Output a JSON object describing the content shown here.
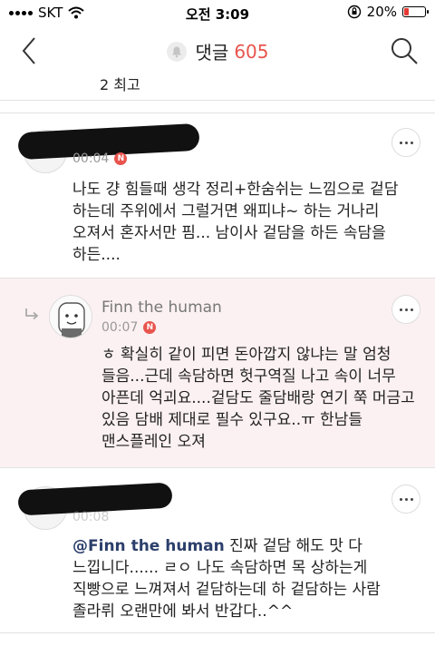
{
  "status_bar": {
    "carrier": "SKT",
    "time": "오전 3:09",
    "battery_percent": "20%",
    "battery_level": 0.2
  },
  "header": {
    "title": "댓글",
    "count": "605"
  },
  "sort": {
    "label": "2  최고"
  },
  "comments": [
    {
      "time": "00:04",
      "badge": "N",
      "lines": [
        "나도 걍 힘들때 생각 정리+한숨쉬는 느낌으로 겉담",
        "하는데 주위에서 그럴거면 왜피냐~ 하는 거나리",
        "오져서 혼자서만 핌... 남이사 겉담을 하든 속담을",
        "하든...."
      ]
    },
    {
      "author": "Finn the human",
      "time": "00:07",
      "badge": "N",
      "lines": [
        "ㅎ 확실히 같이 피면 돈아깝지 않냐는 말 엄청",
        "들음...근데 속담하면 헛구역질 나고 속이 너무",
        "아픈데 억괴요....겉담도 줄담배랑 연기 쭉 머금고",
        "있음 담배 제대로 필수 있구요..ㅠ 한남들",
        "맨스플레인 오져"
      ]
    },
    {
      "time": "00:08",
      "mention": "@Finn the human",
      "lines": [
        " 진짜 겉담 해도 맛 다",
        "느낍니다...... ㄹㅇ 나도 속담하면 목 상하는게",
        "직빵으로 느껴져서 겉담하는데 하 겉담하는 사람",
        "졸라뤼 오랜만에 봐서 반갑다..^^"
      ]
    }
  ],
  "colors": {
    "accent": "#e8554e",
    "reply_bg": "#fcf1f2",
    "mention": "#2c3f6b"
  },
  "icons": {
    "back": "chevron-left-icon",
    "bell": "bell-icon",
    "search": "search-icon",
    "more": "more-icon",
    "reply": "reply-arrow-icon"
  }
}
